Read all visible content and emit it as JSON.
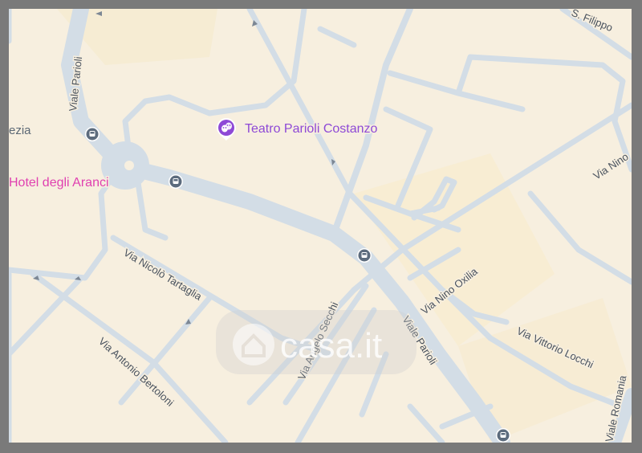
{
  "map": {
    "poi": {
      "theatre": {
        "label": "Teatro Parioli Costanzo",
        "color": "#8e49d6",
        "icon": "theatre-masks-icon"
      },
      "hotel": {
        "label": "Hotel degli Aranci",
        "color": "#e040b0"
      }
    },
    "area_fragment": "ezia",
    "streets": {
      "viale_parioli_upper": "Viale Parioli",
      "viale_parioli_lower": "Viale Parioli",
      "via_nicolo_tartaglia": "Via Nicolò Tartaglia",
      "via_antonio_bertoloni": "Via Antonio Bertoloni",
      "via_angelo_secchi": "Via Angelo Secchi",
      "via_nino_oxilia": "Via Nino Oxilia",
      "via_nino_oxilia_2": "Via Nino",
      "via_vittorio_locchi": "Via Vittorio Locchi",
      "viale_romania": "Viale Romania",
      "via_s_filippo": "S. Filippo"
    },
    "watermark": "casa.it",
    "bus_stop_icon": "bus-stop-icon",
    "colors": {
      "land": "#f7efdf",
      "road": "#d3dde6",
      "road_label": "#49525e",
      "frame": "#7a7a7a"
    }
  }
}
